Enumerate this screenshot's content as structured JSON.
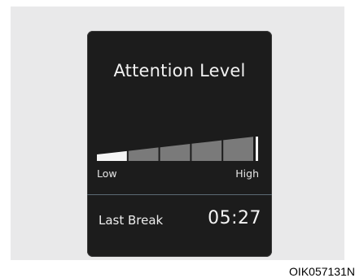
{
  "display": {
    "title": "Attention Level",
    "meter": {
      "level_fraction": 0.2,
      "segments": 5,
      "low_label": "Low",
      "high_label": "High"
    },
    "last_break": {
      "label": "Last Break",
      "time": "05:27"
    }
  },
  "figure_code": "OIK057131N",
  "colors": {
    "screen_bg": "#1c1c1c",
    "backdrop": "#e9e9ea",
    "meter_active": "#f5f5f5",
    "meter_inactive": "#7a7a7a",
    "divider": "#5c6a73"
  }
}
